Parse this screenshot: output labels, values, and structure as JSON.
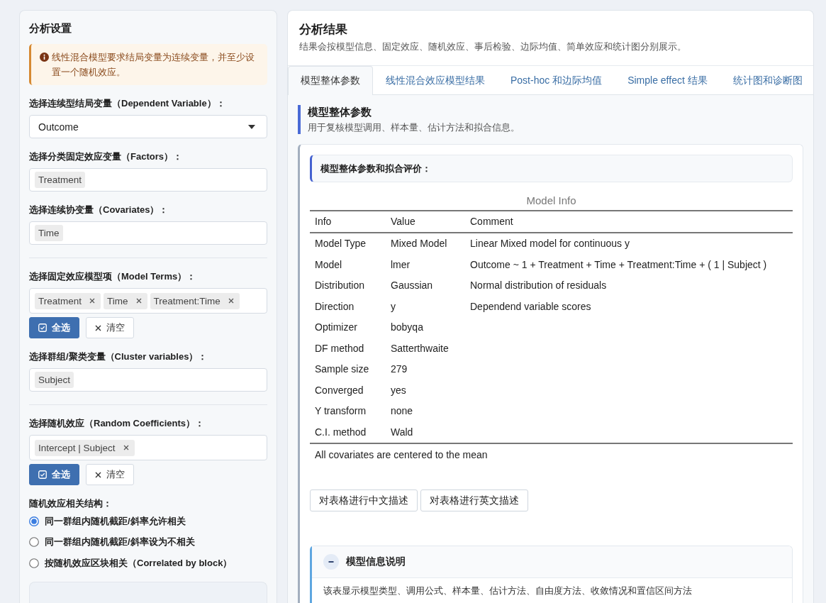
{
  "settings_panel": {
    "title": "分析设置",
    "alert": "线性混合模型要求结局变量为连续变量，并至少设置一个随机效应。",
    "sections": [
      {
        "fields": [
          {
            "kind": "select",
            "label": "选择连续型结局变量（Dependent Variable）：",
            "value": "Outcome"
          },
          {
            "kind": "multi_select",
            "label": "选择分类固定效应变量（Factors）：",
            "tags": [
              {
                "text": "Treatment",
                "removable": false
              }
            ]
          },
          {
            "kind": "multi_select",
            "label": "选择连续协变量（Covariates）：",
            "tags": [
              {
                "text": "Time",
                "removable": false
              }
            ]
          }
        ]
      },
      {
        "fields": [
          {
            "kind": "multi_select",
            "label": "选择固定效应模型项（Model Terms）：",
            "tags": [
              {
                "text": "Treatment",
                "removable": true
              },
              {
                "text": "Time",
                "removable": true
              },
              {
                "text": "Treatment:Time",
                "removable": true
              }
            ],
            "actions": [
              {
                "kind": "select_all",
                "label": "全选"
              },
              {
                "kind": "clear",
                "label": "清空"
              }
            ]
          },
          {
            "kind": "multi_select",
            "label": "选择群组/聚类变量（Cluster variables）：",
            "tags": [
              {
                "text": "Subject",
                "removable": false
              }
            ]
          }
        ]
      },
      {
        "fields": [
          {
            "kind": "multi_select",
            "label": "选择随机效应（Random Coefficients）：",
            "tags": [
              {
                "text": "Intercept | Subject",
                "removable": true
              }
            ],
            "actions": [
              {
                "kind": "select_all",
                "label": "全选"
              },
              {
                "kind": "clear",
                "label": "清空"
              }
            ]
          },
          {
            "kind": "radio",
            "label": "随机效应相关结构：",
            "options": [
              {
                "label": "同一群组内随机截距/斜率允许相关",
                "selected": true
              },
              {
                "label": "同一群组内随机截距/斜率设为不相关",
                "selected": false
              },
              {
                "label": "按随机效应区块相关（Correlated by block）",
                "selected": false
              }
            ]
          }
        ]
      }
    ]
  },
  "results_panel": {
    "title": "分析结果",
    "subtitle": "结果会按模型信息、固定效应、随机效应、事后检验、边际均值、简单效应和统计图分别展示。",
    "tabs": [
      {
        "label": "模型整体参数",
        "selected": true
      },
      {
        "label": "线性混合效应模型结果",
        "selected": false
      },
      {
        "label": "Post-hoc 和边际均值",
        "selected": false
      },
      {
        "label": "Simple effect 结果",
        "selected": false
      },
      {
        "label": "统计图和诊断图",
        "selected": false
      }
    ],
    "section": {
      "title": "模型整体参数",
      "subtitle": "用于复核模型调用、样本量、估计方法和拟合信息。",
      "card": {
        "heading": "模型整体参数和拟合评价：",
        "table": {
          "caption": "Model Info",
          "columns": [
            "Info",
            "Value",
            "Comment"
          ],
          "rows": [
            [
              "Model Type",
              "Mixed Model",
              "Linear Mixed model for continuous y"
            ],
            [
              "Model",
              "lmer",
              "Outcome ~ 1 + Treatment + Time + Treatment:Time + ( 1 | Subject )"
            ],
            [
              "Distribution",
              "Gaussian",
              "Normal distribution of residuals"
            ],
            [
              "Direction",
              "y",
              "Dependend variable scores"
            ],
            [
              "Optimizer",
              "bobyqa"
            ],
            [
              "DF method",
              "Satterthwaite"
            ],
            [
              "Sample size",
              "279"
            ],
            [
              "Converged",
              "yes"
            ],
            [
              "Y transform",
              "none"
            ],
            [
              "C.I. method",
              "Wald"
            ]
          ],
          "footnote": "All covariates are centered to the mean"
        },
        "buttons": [
          "对表格进行中文描述",
          "对表格进行英文描述"
        ]
      },
      "explanation": {
        "title": "模型信息说明",
        "expanded": true,
        "text": "该表显示模型类型、调用公式、样本量、估计方法、自由度方法、收敛情况和置信区间方法"
      }
    }
  }
}
